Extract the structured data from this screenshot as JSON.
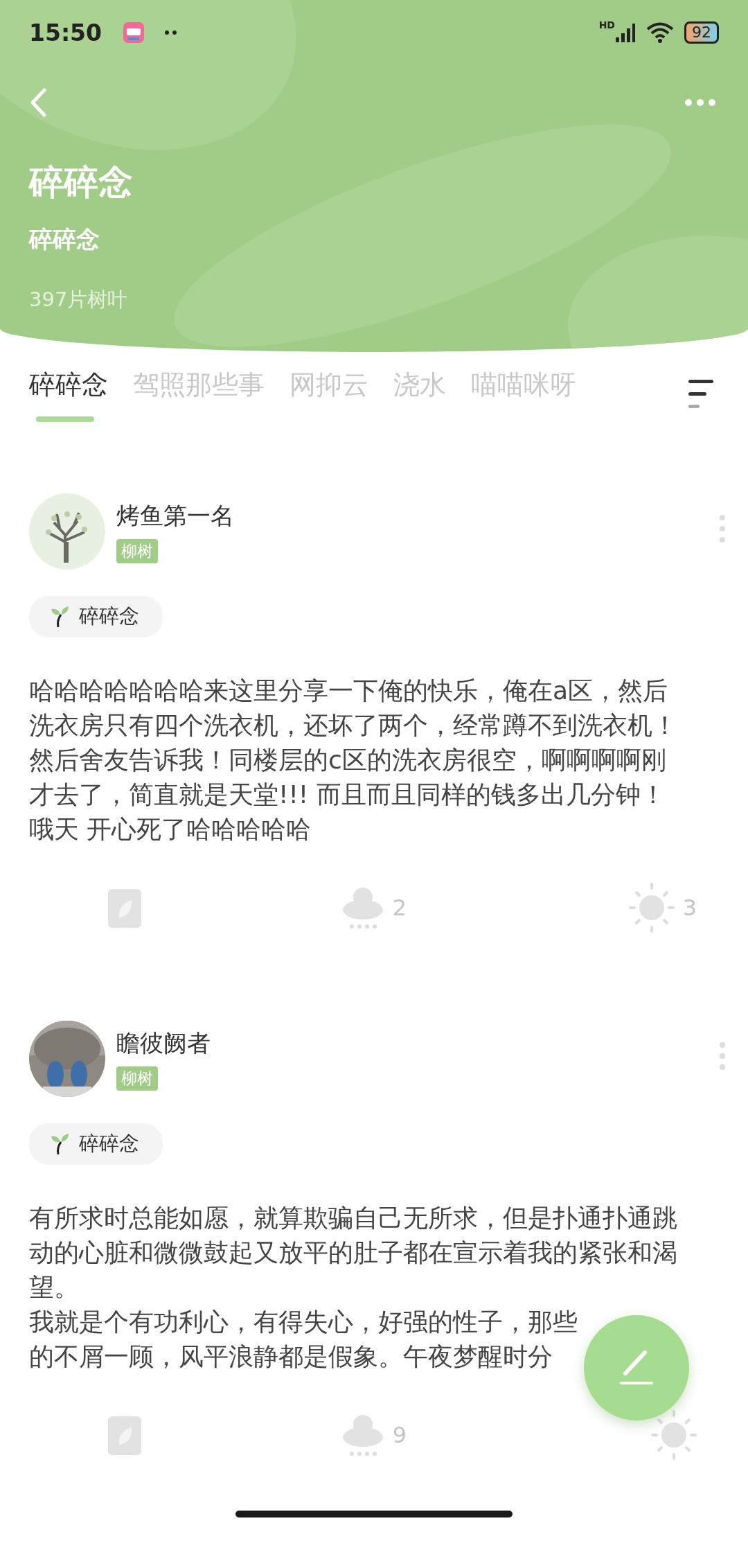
{
  "status_bar": {
    "time": "15:50",
    "network": "HD",
    "battery": "92"
  },
  "header": {
    "title": "碎碎念",
    "subtitle": "碎碎念",
    "leaf_count": "397片树叶"
  },
  "tabs": [
    {
      "label": "碎碎念",
      "selected": true
    },
    {
      "label": "驾照那些事",
      "selected": false
    },
    {
      "label": "网抑云",
      "selected": false
    },
    {
      "label": "浇水",
      "selected": false
    },
    {
      "label": "喵喵咪呀",
      "selected": false
    }
  ],
  "posts": [
    {
      "author": "烤鱼第一名",
      "badge": "柳树",
      "avatar": {
        "kind": "tree"
      },
      "topic": "碎碎念",
      "paragraphs": [
        "哈哈哈哈哈哈哈来这里分享一下俺的快乐，俺在a区，然后洗衣房只有四个洗衣机，还坏了两个，经常蹲不到洗衣机！然后舍友告诉我！同楼层的c区的洗衣房很空，啊啊啊啊刚才去了，简直就是天堂!!! 而且而且同样的钱多出几分钟！哦天 开心死了哈哈哈哈哈"
      ],
      "comments": "2",
      "likes": "3"
    },
    {
      "author": "瞻彼阙者",
      "badge": "柳树",
      "topic": "碎碎念",
      "paragraphs": [
        "有所求时总能如愿，就算欺骗自己无所求，但是扑通扑通跳动的心脏和微微鼓起又放平的肚子都在宣示着我的紧张和渴望。",
        "我就是个有功利心，有得失心，好强的性子，那些",
        "的不屑一顾，风平浪静都是假象。午夜梦醒时分"
      ],
      "comments": "9"
    }
  ]
}
